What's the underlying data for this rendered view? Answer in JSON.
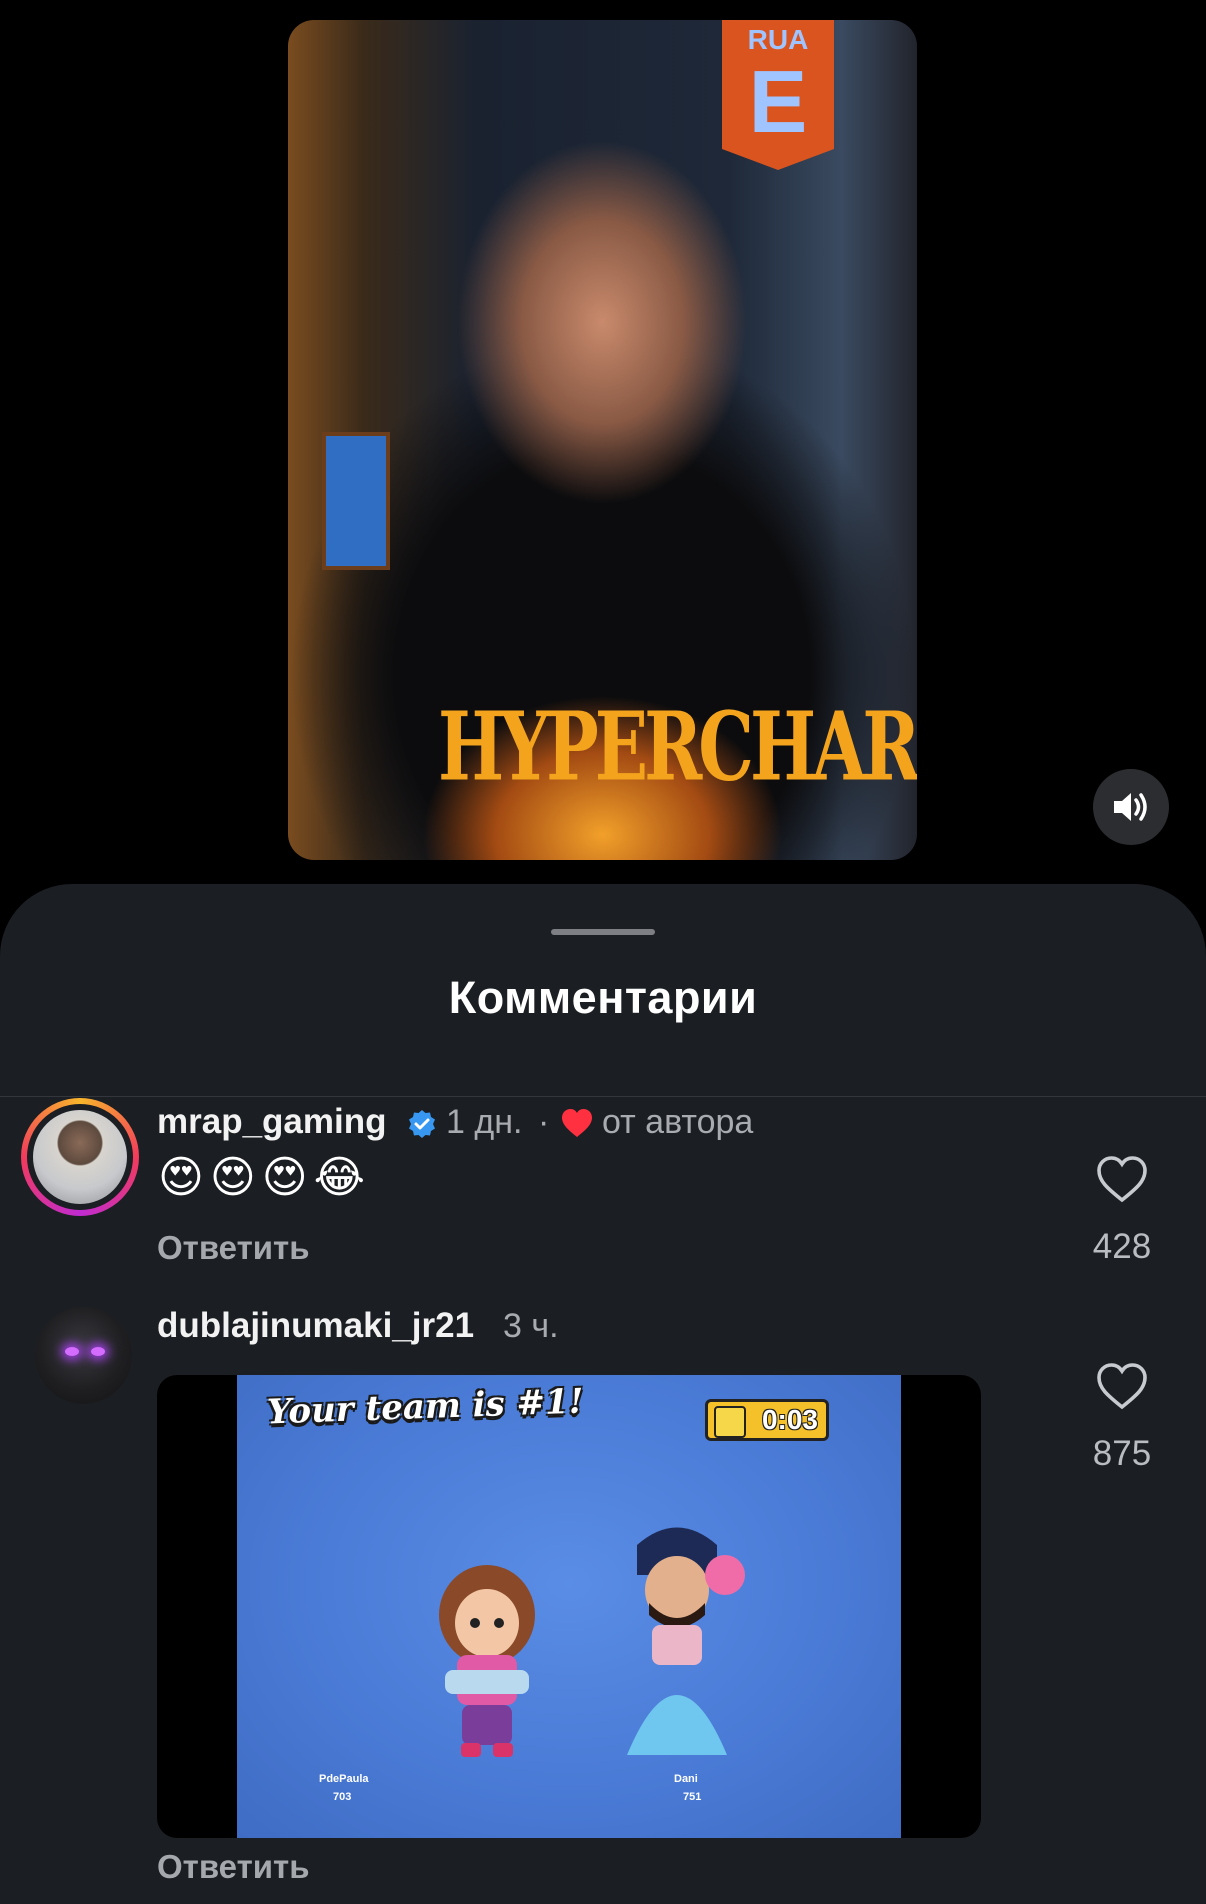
{
  "video": {
    "banner_top": "RUA",
    "banner_letter": "E",
    "shirt_text": "HYPERCHARGED"
  },
  "sheet": {
    "title": "Комментарии"
  },
  "comments": [
    {
      "username": "mrap_gaming",
      "verified": true,
      "time": "1 дн.",
      "separator": "·",
      "liked_by_author_label": "от автора",
      "text": "😍😍😍😂",
      "reply_label": "Ответить",
      "likes": "428"
    },
    {
      "username": "dublajinumaki_jr21",
      "time": "3 ч.",
      "media": {
        "headline": "Your team is #1!",
        "timer": "0:03",
        "player_left": "PdePaula",
        "player_left_trophies": "703",
        "player_right": "Dani",
        "player_right_trophies": "751"
      },
      "reply_label": "Ответить",
      "likes": "875"
    }
  ],
  "colors": {
    "background": "#000000",
    "sheet": "#1b1e22",
    "verified": "#3897f0",
    "heart_red": "#ff3040",
    "muted_text": "#a8abb0"
  },
  "icons": {
    "sound": "speaker-icon",
    "like": "heart-outline-icon",
    "verified": "verified-badge-icon",
    "author_heart": "heart-filled-icon"
  }
}
